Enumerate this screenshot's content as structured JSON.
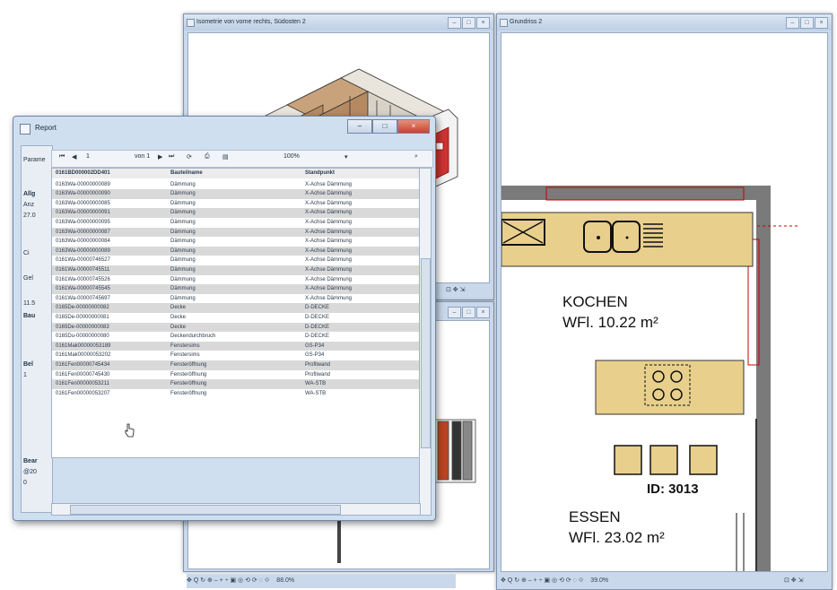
{
  "iso_window": {
    "title": "Isometrie von vorne rechts, Südosten 2",
    "buttons": [
      "–",
      "□",
      "×"
    ],
    "footer_icons": "⊡ ✥ ⇲"
  },
  "plan_window": {
    "title": "Grundriss 2",
    "buttons": [
      "–",
      "□",
      "×"
    ],
    "footer_icons": "⊡ ✥ ⇲",
    "rooms": [
      {
        "name": "KOCHEN",
        "area": "WFl. 10.22 m²"
      },
      {
        "name": "ESSEN",
        "area": "WFl. 23.02 m²"
      }
    ],
    "id_label": "ID: 3013"
  },
  "mid_window": {
    "buttons": [
      "–",
      "□",
      "×"
    ]
  },
  "bottom_toolbar": {
    "left_icons": "✥ Q ↻ ⊕ – + ÷ ▣ ◎ ⟲ ⟳ ◌ ⟐",
    "left_zoom": "88.0%",
    "right_icons": "✥ Q ↻ ⊕ – + ÷ ▣ ◎ ⟲ ⟳ ◌ ⟐",
    "right_zoom": "39.0%"
  },
  "report": {
    "title": "Report",
    "window_buttons": [
      "–",
      "□",
      "×"
    ],
    "toolbar": {
      "params_label": "Parame",
      "page_input": "1",
      "page_of": "von 1",
      "zoom": "100%"
    },
    "left_pane": [
      "Allg",
      "Anz",
      "27.0",
      "Ci",
      "Gel",
      "11.5",
      "Bau",
      "Bel",
      "1",
      "Bear",
      "@20",
      "0"
    ],
    "columns": [
      "0161BD000002DD401",
      "Bauteilname",
      "Standpunkt"
    ],
    "rows": [
      [
        "0163Wa-00000000089",
        "Dämmung",
        "X-Achse Dämmung"
      ],
      [
        "0163Wa-00000000090",
        "Dämmung",
        "X-Achse Dämmung"
      ],
      [
        "0163Wa-00000000085",
        "Dämmung",
        "X-Achse Dämmung"
      ],
      [
        "0163Wa-00000000091",
        "Dämmung",
        "X-Achse Dämmung"
      ],
      [
        "0163Wa-00000000095",
        "Dämmung",
        "X-Achse Dämmung"
      ],
      [
        "0163Wa-00000000087",
        "Dämmung",
        "X-Achse Dämmung"
      ],
      [
        "0163Wa-00000000084",
        "Dämmung",
        "X-Achse Dämmung"
      ],
      [
        "0163Wa-00000000089",
        "Dämmung",
        "X-Achse Dämmung"
      ],
      [
        "0161Wa-00000746527",
        "Dämmung",
        "X-Achse Dämmung"
      ],
      [
        "0161Wa-00000745511",
        "Dämmung",
        "X-Achse Dämmung"
      ],
      [
        "0161Wa-00000745526",
        "Dämmung",
        "X-Achse Dämmung"
      ],
      [
        "0161Wa-00000745545",
        "Dämmung",
        "X-Achse Dämmung"
      ],
      [
        "0161Wa-00000745697",
        "Dämmung",
        "X-Achse Dämmung"
      ],
      [
        "0165De-00000000082",
        "Decke",
        "D-DECKE"
      ],
      [
        "0165De-00000000081",
        "Decke",
        "D-DECKE"
      ],
      [
        "0165De-00000000083",
        "Decke",
        "D-DECKE"
      ],
      [
        "0165Du-00000000080",
        "Deckendurchbruch",
        "D-DECKE"
      ],
      [
        "0161Mak00000053189",
        "Fenstersims",
        "GS-P34"
      ],
      [
        "0161Mak00000053202",
        "Fenstersims",
        "GS-P34"
      ],
      [
        "0161Fen00000745434",
        "Fensteröffnung",
        "Profilwand"
      ],
      [
        "0161Fen00000745430",
        "Fensteröffnung",
        "Profilwand"
      ],
      [
        "0161Fen00000053211",
        "Fensteröffnung",
        "WA-STB"
      ],
      [
        "0161Fen00000053207",
        "Fensteröffnung",
        "WA-STB"
      ]
    ]
  }
}
